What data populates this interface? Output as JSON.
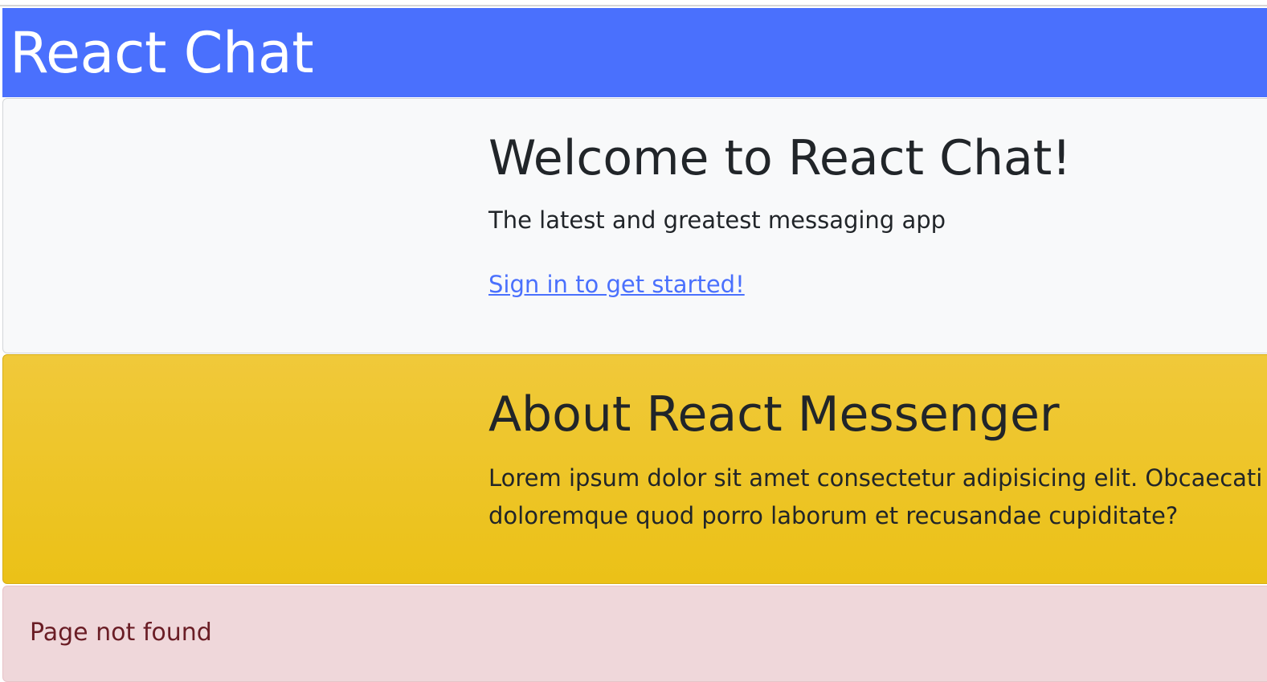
{
  "header": {
    "brand": "React Chat"
  },
  "welcome": {
    "title": "Welcome to React Chat!",
    "subtitle": "The latest and greatest messaging app",
    "signin_link": "Sign in to get started!"
  },
  "about": {
    "title": "About React Messenger",
    "text": "Lorem ipsum dolor sit amet consectetur adipisicing elit. Obcaecati te doloremque quod porro laborum et recusandae cupiditate?"
  },
  "alert": {
    "text": "Page not found"
  },
  "colors": {
    "navbar": "#4a70fd",
    "link": "#4a70fd",
    "about_bg": "#ebc117",
    "alert_bg": "#efd7da",
    "alert_text": "#6a1d25"
  }
}
